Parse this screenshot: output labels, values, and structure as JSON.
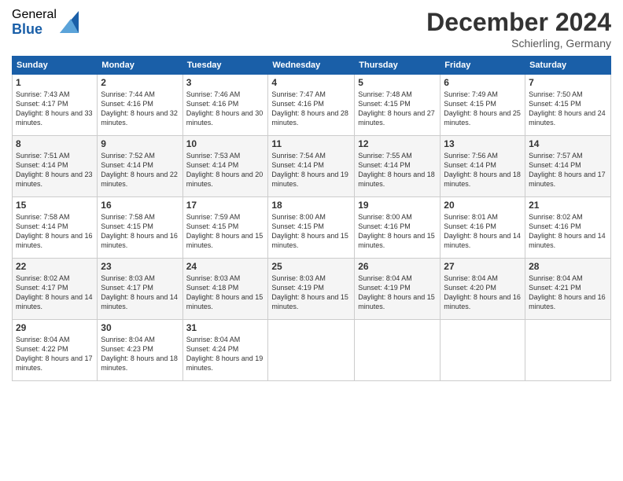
{
  "logo": {
    "general": "General",
    "blue": "Blue"
  },
  "title": "December 2024",
  "location": "Schierling, Germany",
  "days_header": [
    "Sunday",
    "Monday",
    "Tuesday",
    "Wednesday",
    "Thursday",
    "Friday",
    "Saturday"
  ],
  "weeks": [
    [
      {
        "num": "1",
        "sunrise": "Sunrise: 7:43 AM",
        "sunset": "Sunset: 4:17 PM",
        "daylight": "Daylight: 8 hours and 33 minutes."
      },
      {
        "num": "2",
        "sunrise": "Sunrise: 7:44 AM",
        "sunset": "Sunset: 4:16 PM",
        "daylight": "Daylight: 8 hours and 32 minutes."
      },
      {
        "num": "3",
        "sunrise": "Sunrise: 7:46 AM",
        "sunset": "Sunset: 4:16 PM",
        "daylight": "Daylight: 8 hours and 30 minutes."
      },
      {
        "num": "4",
        "sunrise": "Sunrise: 7:47 AM",
        "sunset": "Sunset: 4:16 PM",
        "daylight": "Daylight: 8 hours and 28 minutes."
      },
      {
        "num": "5",
        "sunrise": "Sunrise: 7:48 AM",
        "sunset": "Sunset: 4:15 PM",
        "daylight": "Daylight: 8 hours and 27 minutes."
      },
      {
        "num": "6",
        "sunrise": "Sunrise: 7:49 AM",
        "sunset": "Sunset: 4:15 PM",
        "daylight": "Daylight: 8 hours and 25 minutes."
      },
      {
        "num": "7",
        "sunrise": "Sunrise: 7:50 AM",
        "sunset": "Sunset: 4:15 PM",
        "daylight": "Daylight: 8 hours and 24 minutes."
      }
    ],
    [
      {
        "num": "8",
        "sunrise": "Sunrise: 7:51 AM",
        "sunset": "Sunset: 4:14 PM",
        "daylight": "Daylight: 8 hours and 23 minutes."
      },
      {
        "num": "9",
        "sunrise": "Sunrise: 7:52 AM",
        "sunset": "Sunset: 4:14 PM",
        "daylight": "Daylight: 8 hours and 22 minutes."
      },
      {
        "num": "10",
        "sunrise": "Sunrise: 7:53 AM",
        "sunset": "Sunset: 4:14 PM",
        "daylight": "Daylight: 8 hours and 20 minutes."
      },
      {
        "num": "11",
        "sunrise": "Sunrise: 7:54 AM",
        "sunset": "Sunset: 4:14 PM",
        "daylight": "Daylight: 8 hours and 19 minutes."
      },
      {
        "num": "12",
        "sunrise": "Sunrise: 7:55 AM",
        "sunset": "Sunset: 4:14 PM",
        "daylight": "Daylight: 8 hours and 18 minutes."
      },
      {
        "num": "13",
        "sunrise": "Sunrise: 7:56 AM",
        "sunset": "Sunset: 4:14 PM",
        "daylight": "Daylight: 8 hours and 18 minutes."
      },
      {
        "num": "14",
        "sunrise": "Sunrise: 7:57 AM",
        "sunset": "Sunset: 4:14 PM",
        "daylight": "Daylight: 8 hours and 17 minutes."
      }
    ],
    [
      {
        "num": "15",
        "sunrise": "Sunrise: 7:58 AM",
        "sunset": "Sunset: 4:14 PM",
        "daylight": "Daylight: 8 hours and 16 minutes."
      },
      {
        "num": "16",
        "sunrise": "Sunrise: 7:58 AM",
        "sunset": "Sunset: 4:15 PM",
        "daylight": "Daylight: 8 hours and 16 minutes."
      },
      {
        "num": "17",
        "sunrise": "Sunrise: 7:59 AM",
        "sunset": "Sunset: 4:15 PM",
        "daylight": "Daylight: 8 hours and 15 minutes."
      },
      {
        "num": "18",
        "sunrise": "Sunrise: 8:00 AM",
        "sunset": "Sunset: 4:15 PM",
        "daylight": "Daylight: 8 hours and 15 minutes."
      },
      {
        "num": "19",
        "sunrise": "Sunrise: 8:00 AM",
        "sunset": "Sunset: 4:16 PM",
        "daylight": "Daylight: 8 hours and 15 minutes."
      },
      {
        "num": "20",
        "sunrise": "Sunrise: 8:01 AM",
        "sunset": "Sunset: 4:16 PM",
        "daylight": "Daylight: 8 hours and 14 minutes."
      },
      {
        "num": "21",
        "sunrise": "Sunrise: 8:02 AM",
        "sunset": "Sunset: 4:16 PM",
        "daylight": "Daylight: 8 hours and 14 minutes."
      }
    ],
    [
      {
        "num": "22",
        "sunrise": "Sunrise: 8:02 AM",
        "sunset": "Sunset: 4:17 PM",
        "daylight": "Daylight: 8 hours and 14 minutes."
      },
      {
        "num": "23",
        "sunrise": "Sunrise: 8:03 AM",
        "sunset": "Sunset: 4:17 PM",
        "daylight": "Daylight: 8 hours and 14 minutes."
      },
      {
        "num": "24",
        "sunrise": "Sunrise: 8:03 AM",
        "sunset": "Sunset: 4:18 PM",
        "daylight": "Daylight: 8 hours and 15 minutes."
      },
      {
        "num": "25",
        "sunrise": "Sunrise: 8:03 AM",
        "sunset": "Sunset: 4:19 PM",
        "daylight": "Daylight: 8 hours and 15 minutes."
      },
      {
        "num": "26",
        "sunrise": "Sunrise: 8:04 AM",
        "sunset": "Sunset: 4:19 PM",
        "daylight": "Daylight: 8 hours and 15 minutes."
      },
      {
        "num": "27",
        "sunrise": "Sunrise: 8:04 AM",
        "sunset": "Sunset: 4:20 PM",
        "daylight": "Daylight: 8 hours and 16 minutes."
      },
      {
        "num": "28",
        "sunrise": "Sunrise: 8:04 AM",
        "sunset": "Sunset: 4:21 PM",
        "daylight": "Daylight: 8 hours and 16 minutes."
      }
    ],
    [
      {
        "num": "29",
        "sunrise": "Sunrise: 8:04 AM",
        "sunset": "Sunset: 4:22 PM",
        "daylight": "Daylight: 8 hours and 17 minutes."
      },
      {
        "num": "30",
        "sunrise": "Sunrise: 8:04 AM",
        "sunset": "Sunset: 4:23 PM",
        "daylight": "Daylight: 8 hours and 18 minutes."
      },
      {
        "num": "31",
        "sunrise": "Sunrise: 8:04 AM",
        "sunset": "Sunset: 4:24 PM",
        "daylight": "Daylight: 8 hours and 19 minutes."
      },
      null,
      null,
      null,
      null
    ]
  ]
}
